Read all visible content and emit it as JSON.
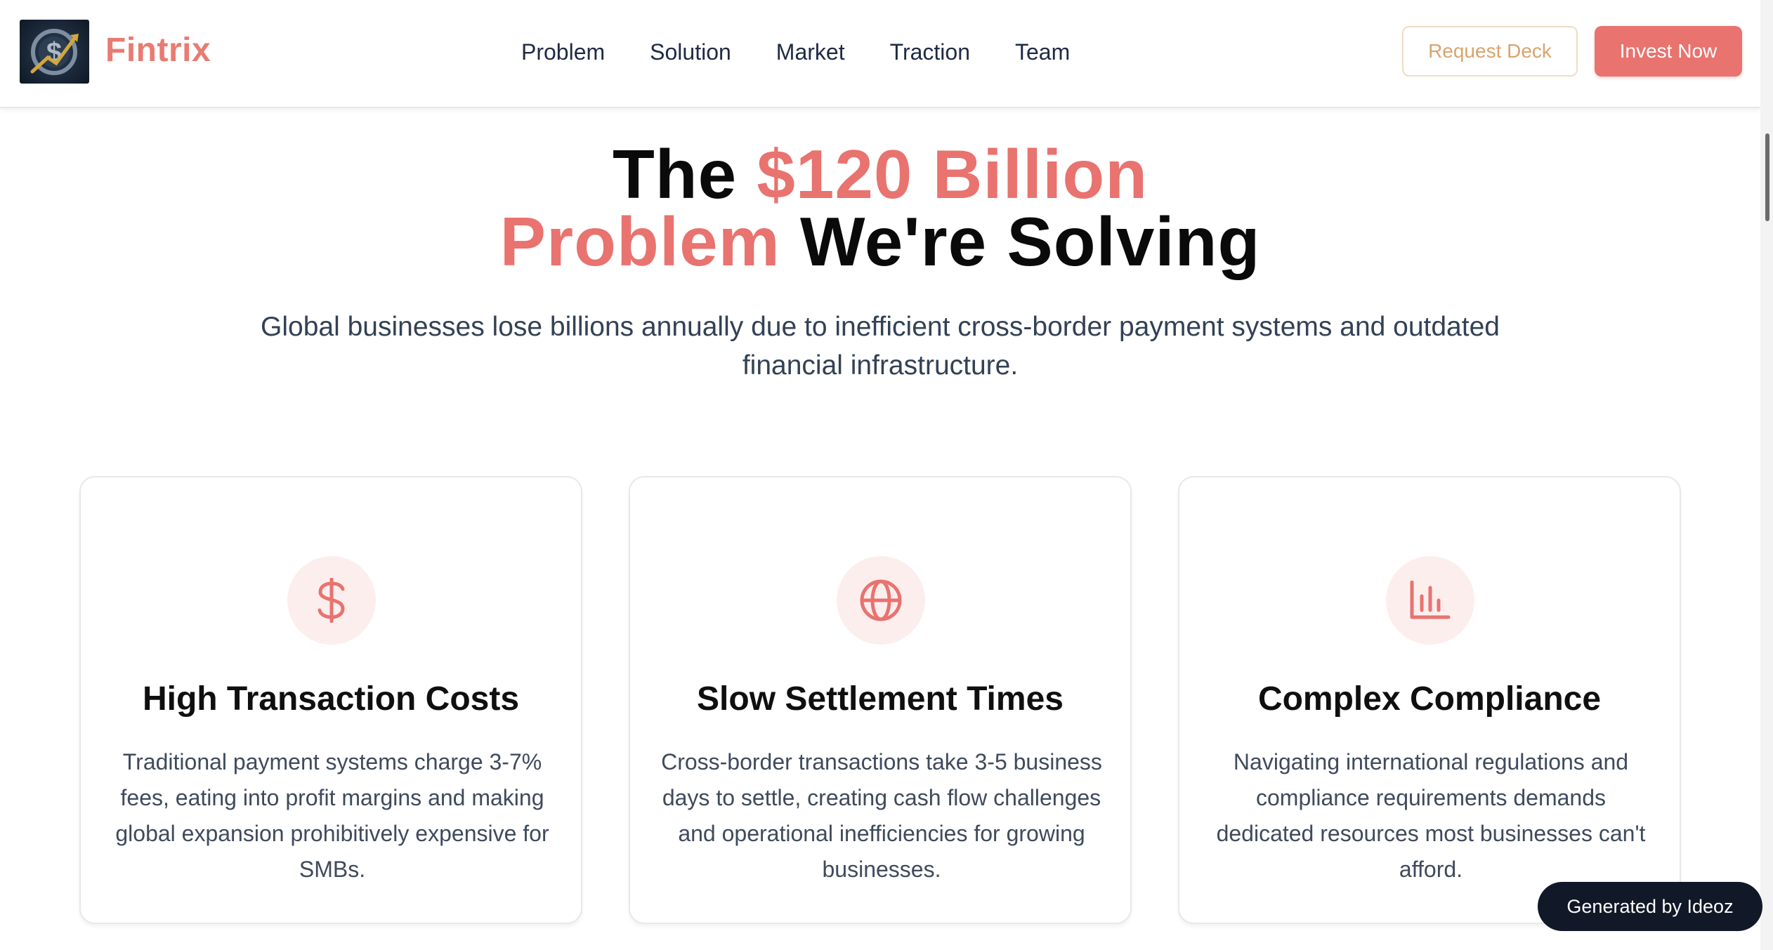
{
  "header": {
    "logo_alt": "Fintrix logo",
    "brand": "Fintrix",
    "nav": [
      "Problem",
      "Solution",
      "Market",
      "Traction",
      "Team"
    ],
    "request_deck": "Request Deck",
    "invest_now": "Invest Now"
  },
  "hero": {
    "line1_a": "The ",
    "line1_b": "$120 Billion",
    "line2_a": "Problem",
    "line2_b": " We're Solving",
    "subtitle": "Global businesses lose billions annually due to inefficient cross-border payment systems and outdated financial infrastructure."
  },
  "cards": [
    {
      "icon": "dollar-icon",
      "title": "High Transaction Costs",
      "text": "Traditional payment systems charge 3-7% fees, eating into profit margins and making global expansion prohibitively expensive for SMBs."
    },
    {
      "icon": "globe-icon",
      "title": "Slow Settlement Times",
      "text": "Cross-border transactions take 3-5 business days to settle, creating cash flow challenges and operational inefficiencies for growing businesses."
    },
    {
      "icon": "bar-chart-icon",
      "title": "Complex Compliance",
      "text": "Navigating international regulations and compliance requirements demands dedicated resources most businesses can't afford."
    }
  ],
  "badge": "Generated by Ideoz",
  "colors": {
    "accent": "#e8736f",
    "accent_light": "#fdeeee",
    "deck_border": "#f0dcc3",
    "deck_text": "#d8a46d",
    "dark": "#111827"
  }
}
